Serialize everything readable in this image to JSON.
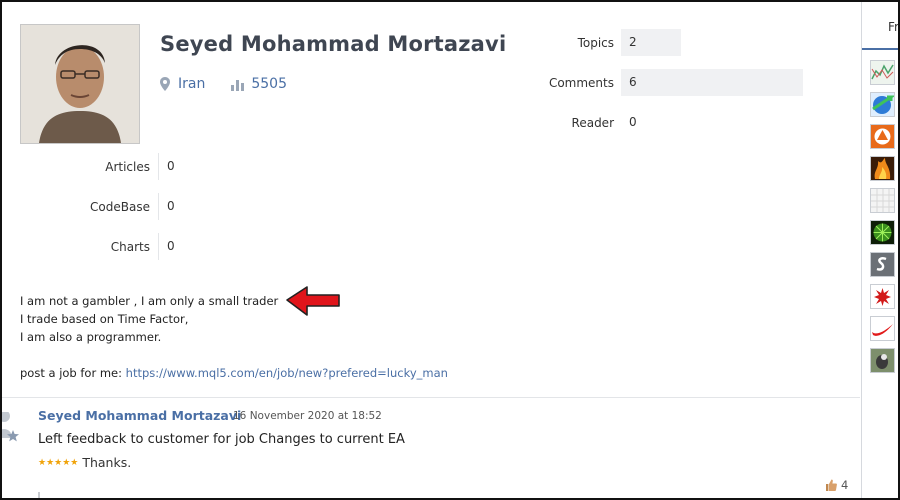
{
  "profile": {
    "name": "Seyed Mohammad Mortazavi",
    "country": "Iran",
    "rating": "5505"
  },
  "stats_top": [
    {
      "label": "Topics",
      "value": "2"
    },
    {
      "label": "Comments",
      "value": "6"
    },
    {
      "label": "Reader",
      "value": "0"
    }
  ],
  "stats_left": [
    {
      "label": "Articles",
      "value": "0"
    },
    {
      "label": "CodeBase",
      "value": "0"
    },
    {
      "label": "Charts",
      "value": "0"
    }
  ],
  "about": {
    "line1": "I am not a gambler , I am only a small trader",
    "line2": "I trade based on Time Factor,",
    "line3": "I am also a programmer.",
    "job_prefix": "post a job for me: ",
    "job_link": "https://www.mql5.com/en/job/new?prefered=lucky_man"
  },
  "feed": {
    "author": "Seyed Mohammad Mortazavi",
    "date": "16 November 2020 at 18:52",
    "title": "Left feedback to customer for job Changes to current EA",
    "stars": "★★★★★",
    "rating_text": "Thanks.",
    "likes": "4"
  },
  "right_panel": {
    "tab_label": "Fr",
    "friends": [
      {
        "icon": "chart-thumb-icon",
        "color": "#eaf2ea"
      },
      {
        "icon": "globe-arrow-icon",
        "color": "#2e7bd6"
      },
      {
        "icon": "orange-badge-icon",
        "color": "#e86a1a"
      },
      {
        "icon": "fire-icon",
        "color": "#c2520f"
      },
      {
        "icon": "pattern-icon",
        "color": "#eeeeee"
      },
      {
        "icon": "green-sphere-icon",
        "color": "#1c3b12"
      },
      {
        "icon": "s-logo-icon",
        "color": "#5a5a5a"
      },
      {
        "icon": "red-splat-icon",
        "color": "#ffffff"
      },
      {
        "icon": "swoosh-icon",
        "color": "#ffffff"
      },
      {
        "icon": "bird-photo-icon",
        "color": "#8a9a7a"
      }
    ]
  },
  "colors": {
    "link": "#4a6fa5",
    "arrow": "#e0151b",
    "star": "#f0a30a"
  }
}
